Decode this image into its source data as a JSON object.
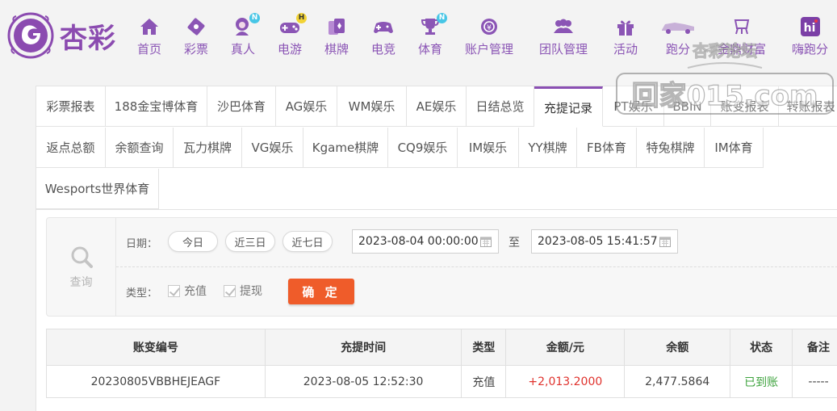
{
  "brand": {
    "name": "杏彩"
  },
  "nav": [
    {
      "label": "首页",
      "icon": "home-icon"
    },
    {
      "label": "彩票",
      "icon": "lottery-icon"
    },
    {
      "label": "真人",
      "icon": "live-dealer-icon",
      "badge": "N"
    },
    {
      "label": "电游",
      "icon": "gamepad-icon",
      "badge": "H"
    },
    {
      "label": "棋牌",
      "icon": "cards-icon"
    },
    {
      "label": "电竞",
      "icon": "esports-controller-icon"
    },
    {
      "label": "体育",
      "icon": "trophy-icon",
      "badge": "N"
    },
    {
      "label": "账户管理",
      "icon": "account-icon"
    },
    {
      "label": "团队管理",
      "icon": "team-icon"
    },
    {
      "label": "活动",
      "icon": "gift-icon"
    },
    {
      "label": "跑分",
      "icon": "car-icon"
    },
    {
      "label": "金鼎财富",
      "icon": "wealth-icon"
    },
    {
      "label": "嗨跑分",
      "icon": "hi-icon"
    }
  ],
  "watermark": {
    "line1": "杏彩论坛",
    "line2": "回家015.com"
  },
  "tabs_row1": [
    "彩票报表",
    "188金宝博体育",
    "沙巴体育",
    "AG娱乐",
    "WM娱乐",
    "AE娱乐",
    "日结总览",
    "充提记录",
    "PT娱乐",
    "BBIN",
    "账变报表",
    "转账报表"
  ],
  "tabs_row2": [
    "返点总额",
    "余额查询",
    "瓦力棋牌",
    "VG娱乐",
    "Kgame棋牌",
    "CQ9娱乐",
    "IM娱乐",
    "YY棋牌",
    "FB体育",
    "特兔棋牌",
    "IM体育"
  ],
  "tabs_row3": [
    "Wesports世界体育"
  ],
  "active_tab": "充提记录",
  "query": {
    "label": "查询",
    "date_label": "日期：",
    "quick": [
      "今日",
      "近三日",
      "近七日"
    ],
    "start": "2023-08-04 00:00:00",
    "to": "至",
    "end": "2023-08-05 15:41:57",
    "type_label": "类型：",
    "types": [
      "充值",
      "提现"
    ],
    "confirm": "确 定"
  },
  "table": {
    "headers": [
      "账变编号",
      "充提时间",
      "类型",
      "金额/元",
      "余额",
      "状态",
      "备注"
    ],
    "rows": [
      [
        "20230805VBBHEJEAGF",
        "2023-08-05 12:52:30",
        "充值",
        "+2,013.2000",
        "2,477.5864",
        "已到账",
        "-----"
      ]
    ]
  },
  "colors": {
    "brand": "#8b4bb0",
    "confirm": "#ef5c2a",
    "amount": "#e0322d",
    "status_ok": "#3ea33e"
  }
}
